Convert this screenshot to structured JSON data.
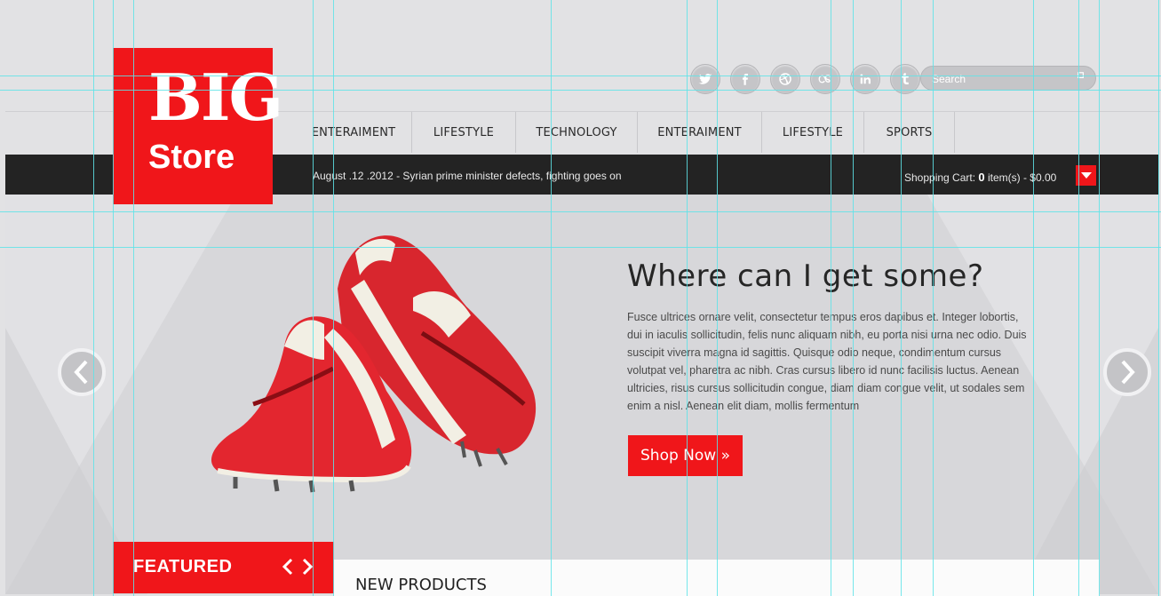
{
  "logo": {
    "line1": "BIG",
    "line2": "Store"
  },
  "social": [
    {
      "icon": "twitter-icon"
    },
    {
      "icon": "facebook-icon"
    },
    {
      "icon": "dribbble-icon"
    },
    {
      "icon": "lastfm-icon"
    },
    {
      "icon": "linkedin-icon"
    },
    {
      "icon": "tumblr-icon"
    }
  ],
  "search": {
    "placeholder": "Search"
  },
  "nav": [
    {
      "label": "ENTERAIMENT"
    },
    {
      "label": "LIFESTYLE"
    },
    {
      "label": "TECHNOLOGY"
    },
    {
      "label": "ENTERAIMENT"
    },
    {
      "label": "LIFESTYLE"
    },
    {
      "label": "SPORTS"
    }
  ],
  "ticker": {
    "text": "August .12 .2012 - Syrian prime minister defects, fighting goes on"
  },
  "cart": {
    "label": "Shopping Cart:",
    "count": "0",
    "suffix": "item(s) - $0.00"
  },
  "hero": {
    "title": "Where can I get some?",
    "body": "Fusce ultrices ornare velit, consectetur tempus eros dapibus et. Integer lobortis, dui in iaculis sollicitudin, felis nunc aliquam nibh, eu porta nisi urna nec odio. Duis suscipit viverra magna id sagittis. Quisque odio neque, condimentum cursus volutpat vel, pharetra ac nibh. Cras cursus libero id nunc facilisis luctus. Aenean ultricies, risus cursus sollicitudin congue, diam diam congue velit, ut sodales sem enim a nisl. Aenean elit diam, mollis fermentum",
    "button": "Shop Now »"
  },
  "featured": {
    "label": "FEATURED"
  },
  "new_products": {
    "label": "NEW PRODUCTS"
  },
  "colors": {
    "brand_red": "#f0161a",
    "bar_dark": "#232323",
    "guide": "#5ee3e8"
  }
}
